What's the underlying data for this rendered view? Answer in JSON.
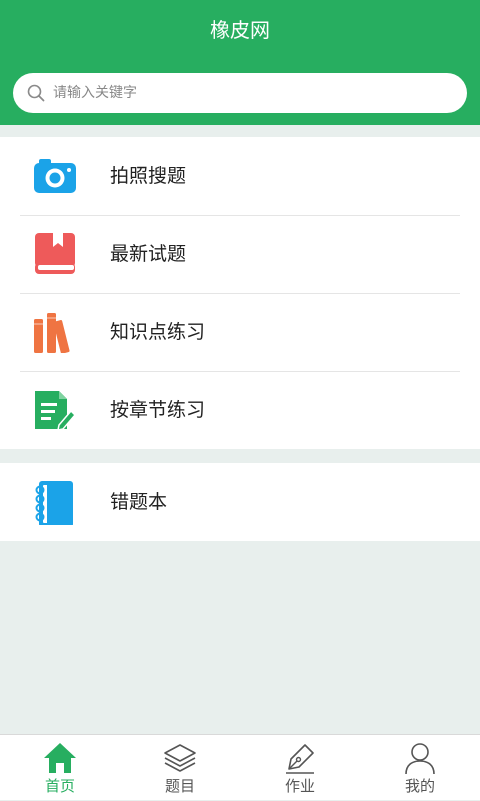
{
  "header": {
    "title": "橡皮网"
  },
  "search": {
    "placeholder": "请输入关键字"
  },
  "menu": {
    "items": [
      {
        "label": "拍照搜题",
        "icon": "camera-icon"
      },
      {
        "label": "最新试题",
        "icon": "book-bookmark-icon"
      },
      {
        "label": "知识点练习",
        "icon": "books-icon"
      },
      {
        "label": "按章节练习",
        "icon": "document-pen-icon"
      },
      {
        "label": "错题本",
        "icon": "notebook-icon"
      }
    ]
  },
  "tabbar": {
    "items": [
      {
        "label": "首页",
        "icon": "home-icon",
        "active": true
      },
      {
        "label": "题目",
        "icon": "layers-icon",
        "active": false
      },
      {
        "label": "作业",
        "icon": "pen-nib-icon",
        "active": false
      },
      {
        "label": "我的",
        "icon": "user-icon",
        "active": false
      }
    ]
  },
  "colors": {
    "brand": "#27ae60",
    "background": "#e8efed",
    "camera": "#1ba3e8",
    "book": "#ee5a5a",
    "books": "#ef7442",
    "document": "#27ae60",
    "notebook": "#1ba3e8"
  }
}
